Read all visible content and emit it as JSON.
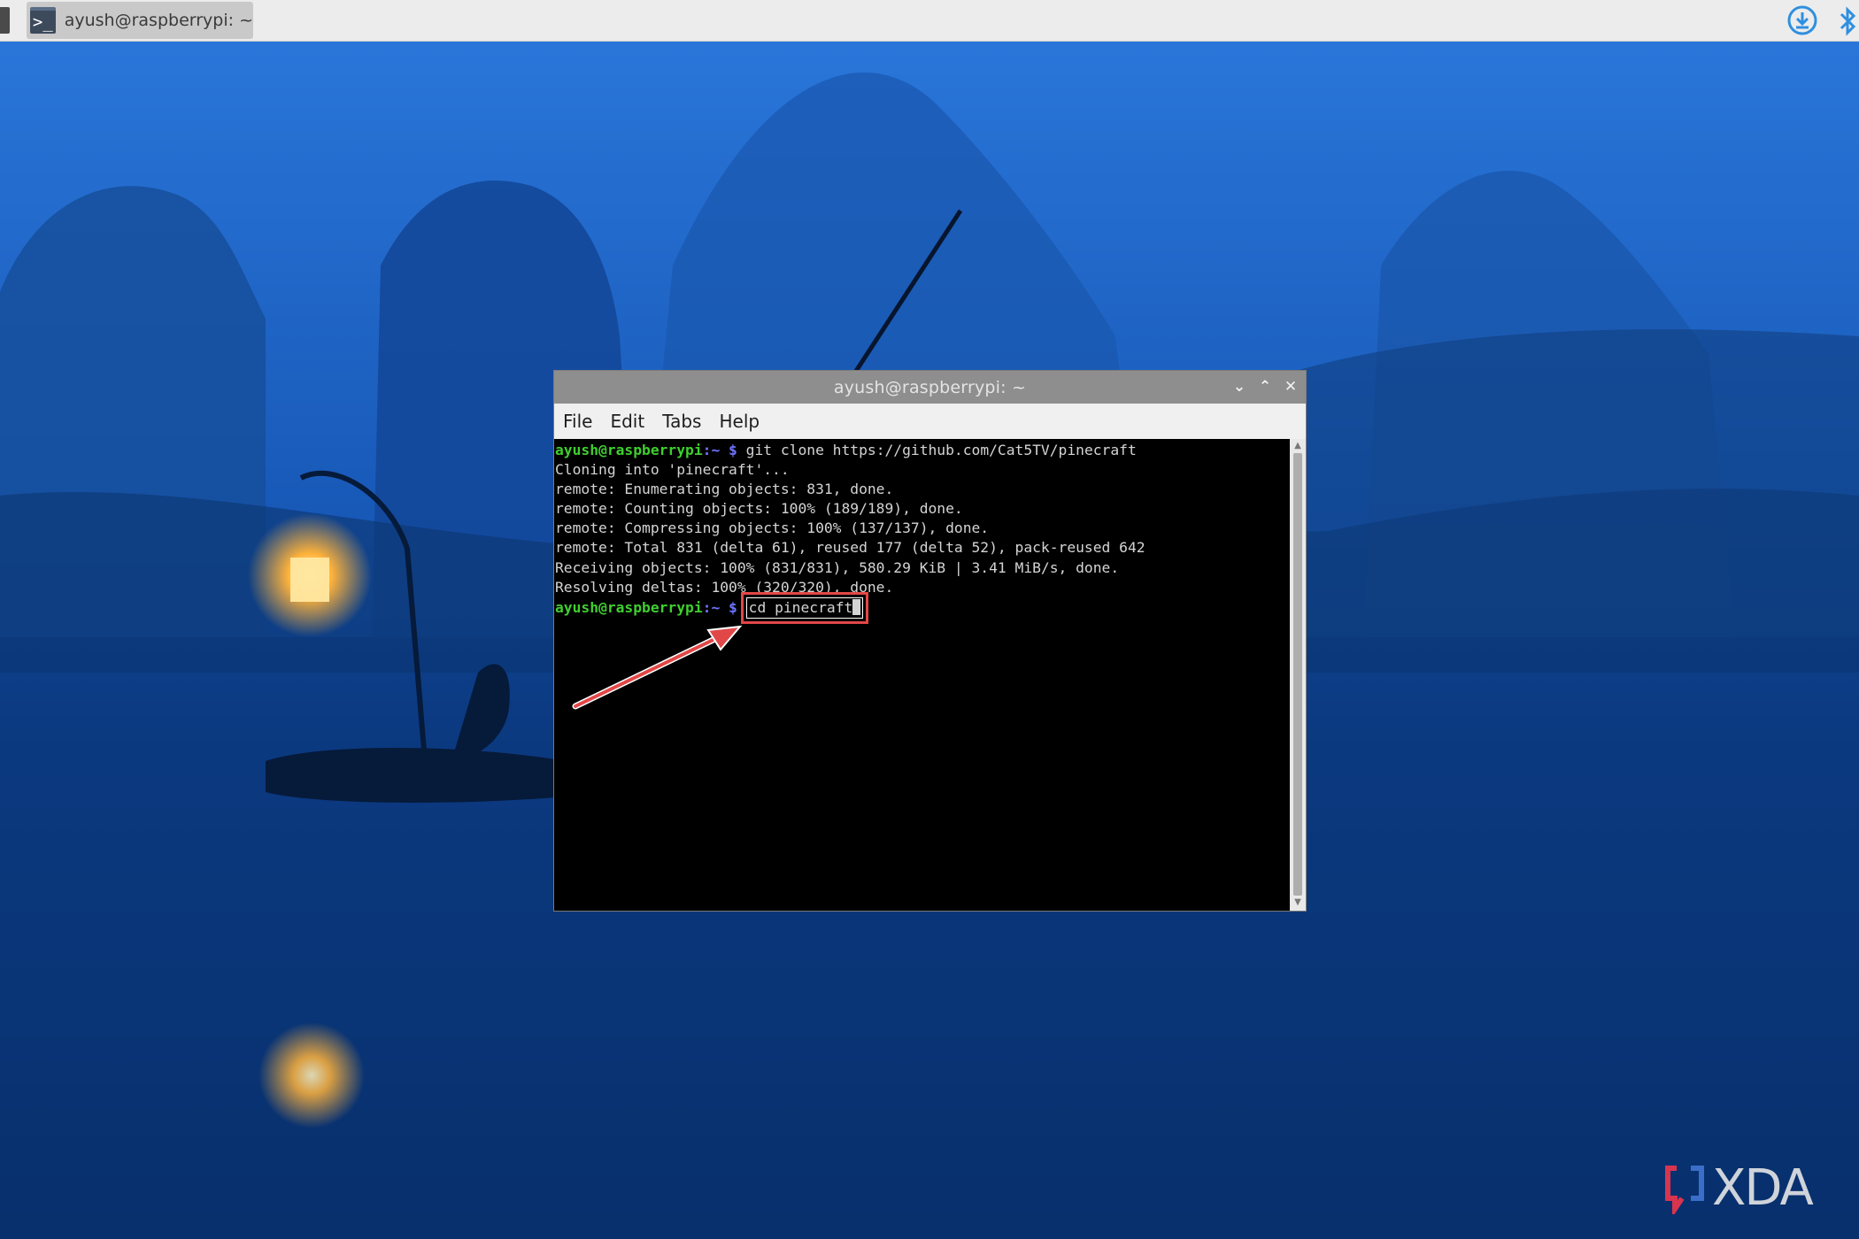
{
  "taskbar": {
    "task_label": "ayush@raspberrypi: ~",
    "task_icon": "terminal-icon",
    "tray_icons": [
      "update-download-icon",
      "bluetooth-icon"
    ]
  },
  "terminal": {
    "title": "ayush@raspberrypi: ~",
    "menu": [
      "File",
      "Edit",
      "Tabs",
      "Help"
    ],
    "prompt_user": "ayush@raspberrypi",
    "prompt_path": ":~ $",
    "first_command": " git clone https://github.com/Cat5TV/pinecraft",
    "output": [
      "Cloning into 'pinecraft'...",
      "remote: Enumerating objects: 831, done.",
      "remote: Counting objects: 100% (189/189), done.",
      "remote: Compressing objects: 100% (137/137), done.",
      "remote: Total 831 (delta 61), reused 177 (delta 52), pack-reused 642",
      "Receiving objects: 100% (831/831), 580.29 KiB | 3.41 MiB/s, done.",
      "Resolving deltas: 100% (320/320), done."
    ],
    "current_command": "cd pinecraft"
  },
  "colors": {
    "prompt_user": "#3fce2f",
    "prompt_path": "#6f74ff",
    "highlight": "#e24747"
  },
  "watermark": {
    "text": "XDA"
  }
}
